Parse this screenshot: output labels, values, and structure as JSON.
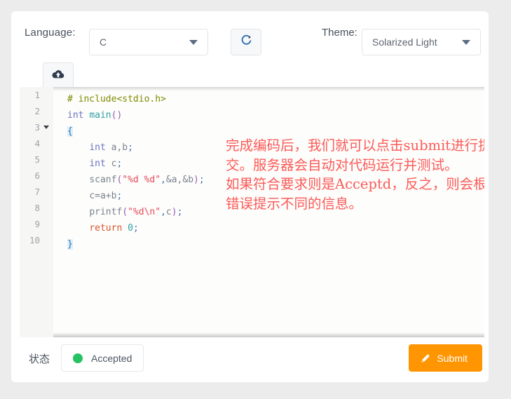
{
  "toolbar": {
    "language_label": "Language:",
    "language_value": "C",
    "theme_label": "Theme:",
    "theme_value": "Solarized Light",
    "refresh_icon": "refresh-icon",
    "upload_icon": "cloud-upload-icon"
  },
  "editor": {
    "line_numbers": [
      "1",
      "2",
      "3",
      "4",
      "5",
      "6",
      "7",
      "8",
      "9",
      "10"
    ],
    "fold_line": "3",
    "code_lines": [
      "# include<stdio.h>",
      "int main()",
      "{",
      "    int a,b;",
      "    int c;",
      "    scanf(\"%d %d\",&a,&b);",
      "    c=a+b;",
      "    printf(\"%d\\n\",c);",
      "    return 0;",
      "}"
    ],
    "tokens": {
      "hash": "#",
      "include": " include<stdio.h>",
      "int": "int",
      "main": "main",
      "open_paren": "(",
      "close_paren": ")",
      "open_brace": "{",
      "close_brace": "}",
      "var_ab": " a,b",
      "var_c": " c",
      "semi": ";",
      "scanf": "scanf",
      "str_scanf": "\"%d %d\"",
      "comma": ",",
      "args_scanf": "&a,&b",
      "assign_c": "c=a+b",
      "printf": "printf",
      "str_printf": "\"%d\\n\"",
      "arg_c": "c",
      "return": "return",
      "zero": " 0",
      "indent": "    "
    }
  },
  "annotation": {
    "color": "#fb5a58",
    "paragraph1": "完成编码后，我们就可以点击submit进行提交。服务器会自动对代码运行并测试。",
    "paragraph2": "如果符合要求则是Acceptd，反之，则会根据错误提示不同的信息。"
  },
  "footer": {
    "state_label": "状态",
    "status_text": "Accepted",
    "status_color": "#27c263",
    "submit_label": "Submit",
    "submit_color": "#ff9500",
    "submit_icon": "pencil-icon"
  }
}
